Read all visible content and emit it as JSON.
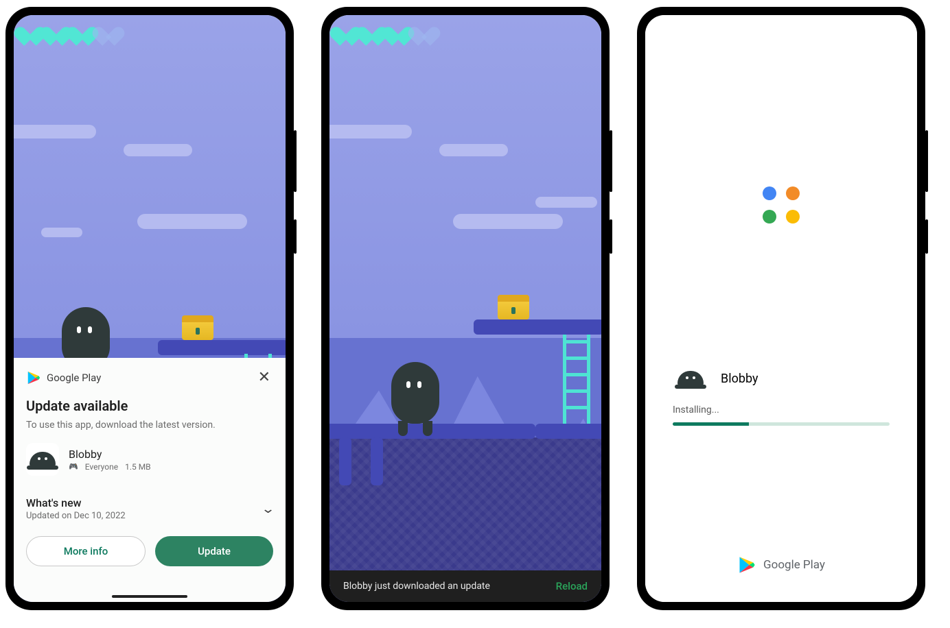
{
  "phone1": {
    "hearts": {
      "full": 3,
      "dim": 1
    },
    "sheet": {
      "store_name": "Google Play",
      "title": "Update available",
      "subtitle": "To use this app, download the latest version.",
      "app": {
        "name": "Blobby",
        "rating_label": "Everyone",
        "size": "1.5 MB"
      },
      "whats_new": {
        "header": "What's new",
        "updated": "Updated on Dec 10, 2022"
      },
      "buttons": {
        "more_info": "More info",
        "update": "Update"
      }
    }
  },
  "phone2": {
    "hearts": {
      "full": 3,
      "dim": 1
    },
    "snackbar": {
      "message": "Blobby just downloaded an update",
      "action": "Reload"
    }
  },
  "phone3": {
    "app_name": "Blobby",
    "status": "Installing...",
    "progress_pct": 35,
    "footer_brand": "Google Play"
  }
}
